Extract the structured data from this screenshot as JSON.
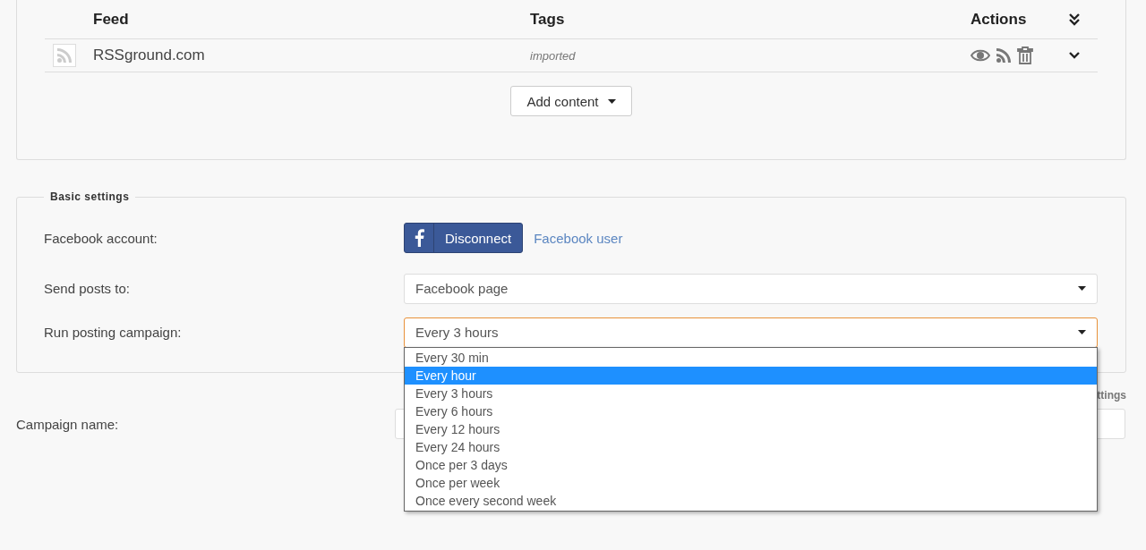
{
  "feed_table": {
    "columns": [
      "Feed",
      "Tags",
      "Actions"
    ],
    "rows": [
      {
        "feed": "RSSground.com",
        "tags": "imported"
      }
    ]
  },
  "add_content_button": "Add content",
  "basic_settings": {
    "legend": "Basic settings",
    "facebook_account": {
      "label": "Facebook account:",
      "button": "Disconnect",
      "user": "Facebook user"
    },
    "send_posts_to": {
      "label": "Send posts to:",
      "value": "Facebook page"
    },
    "run_posting_campaign": {
      "label": "Run posting campaign:",
      "value": "Every 3 hours",
      "expanded": true,
      "options": [
        {
          "label": "Every 30 min",
          "highlighted": false
        },
        {
          "label": "Every hour",
          "highlighted": true
        },
        {
          "label": "Every 3 hours",
          "highlighted": false
        },
        {
          "label": "Every 6 hours",
          "highlighted": false
        },
        {
          "label": "Every 12 hours",
          "highlighted": false
        },
        {
          "label": "Every 24 hours",
          "highlighted": false
        },
        {
          "label": "Once per 3 days",
          "highlighted": false
        },
        {
          "label": "Once per week",
          "highlighted": false
        },
        {
          "label": "Once every second week",
          "highlighted": false
        }
      ]
    }
  },
  "advanced_settings_link": "ttings",
  "campaign_name": {
    "label": "Campaign name:"
  }
}
